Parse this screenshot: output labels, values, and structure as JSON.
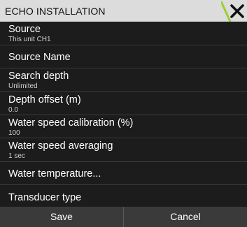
{
  "dialog": {
    "title": "ECHO INSTALLATION",
    "close_icon": "close-icon",
    "accent_color": "#9bcf2f"
  },
  "items": [
    {
      "label": "Source",
      "value": "This unit CH1"
    },
    {
      "label": "Source Name",
      "value": ""
    },
    {
      "label": "Search depth",
      "value": "Unlimited"
    },
    {
      "label": "Depth offset (m)",
      "value": "0.0"
    },
    {
      "label": "Water speed calibration (%)",
      "value": "100"
    },
    {
      "label": "Water speed averaging",
      "value": "1 sec"
    },
    {
      "label": "Water temperature...",
      "value": ""
    },
    {
      "label": "Transducer type",
      "value": ""
    }
  ],
  "footer": {
    "save_label": "Save",
    "cancel_label": "Cancel"
  }
}
